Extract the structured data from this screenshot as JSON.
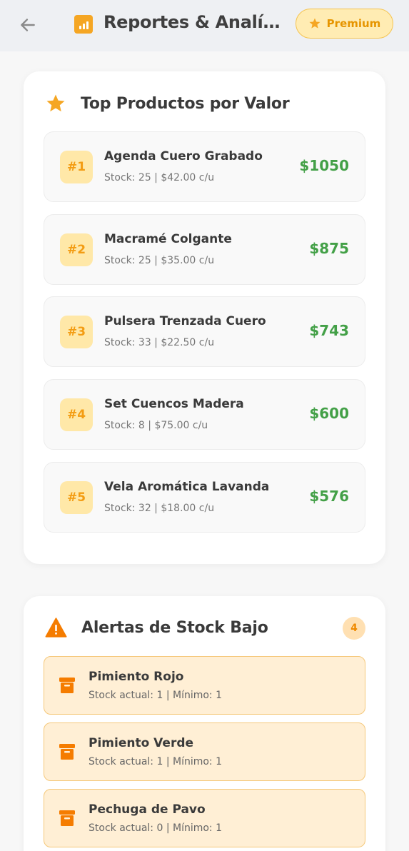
{
  "header": {
    "title": "Reportes & Analíticas",
    "premium_label": "Premium"
  },
  "top_products": {
    "title": "Top Productos por Valor",
    "items": [
      {
        "rank": "#1",
        "name": "Agenda Cuero Grabado",
        "details": "Stock: 25 | $42.00 c/u",
        "value": "$1050"
      },
      {
        "rank": "#2",
        "name": "Macramé Colgante",
        "details": "Stock: 25 | $35.00 c/u",
        "value": "$875"
      },
      {
        "rank": "#3",
        "name": "Pulsera Trenzada Cuero",
        "details": "Stock: 33 | $22.50 c/u",
        "value": "$743"
      },
      {
        "rank": "#4",
        "name": "Set Cuencos Madera",
        "details": "Stock: 8 | $75.00 c/u",
        "value": "$600"
      },
      {
        "rank": "#5",
        "name": "Vela Aromática Lavanda",
        "details": "Stock: 32 | $18.00 c/u",
        "value": "$576"
      }
    ]
  },
  "low_stock": {
    "title": "Alertas de Stock Bajo",
    "count": "4",
    "items": [
      {
        "name": "Pimiento Rojo",
        "details": "Stock actual: 1 | Mínimo: 1"
      },
      {
        "name": "Pimiento Verde",
        "details": "Stock actual: 1 | Mínimo: 1"
      },
      {
        "name": "Pechuga de Pavo",
        "details": "Stock actual: 0 | Mínimo: 1"
      }
    ]
  },
  "colors": {
    "accent": "#f5a623",
    "value_green": "#43a047",
    "alert_bg": "#ffefd5",
    "alert_border": "#f5c87a"
  },
  "icons": {
    "back": "arrow-left-icon",
    "title": "bar-chart-icon",
    "premium": "star-icon",
    "top_products": "star-icon",
    "low_stock": "warning-icon",
    "alert_item": "archive-box-icon"
  }
}
